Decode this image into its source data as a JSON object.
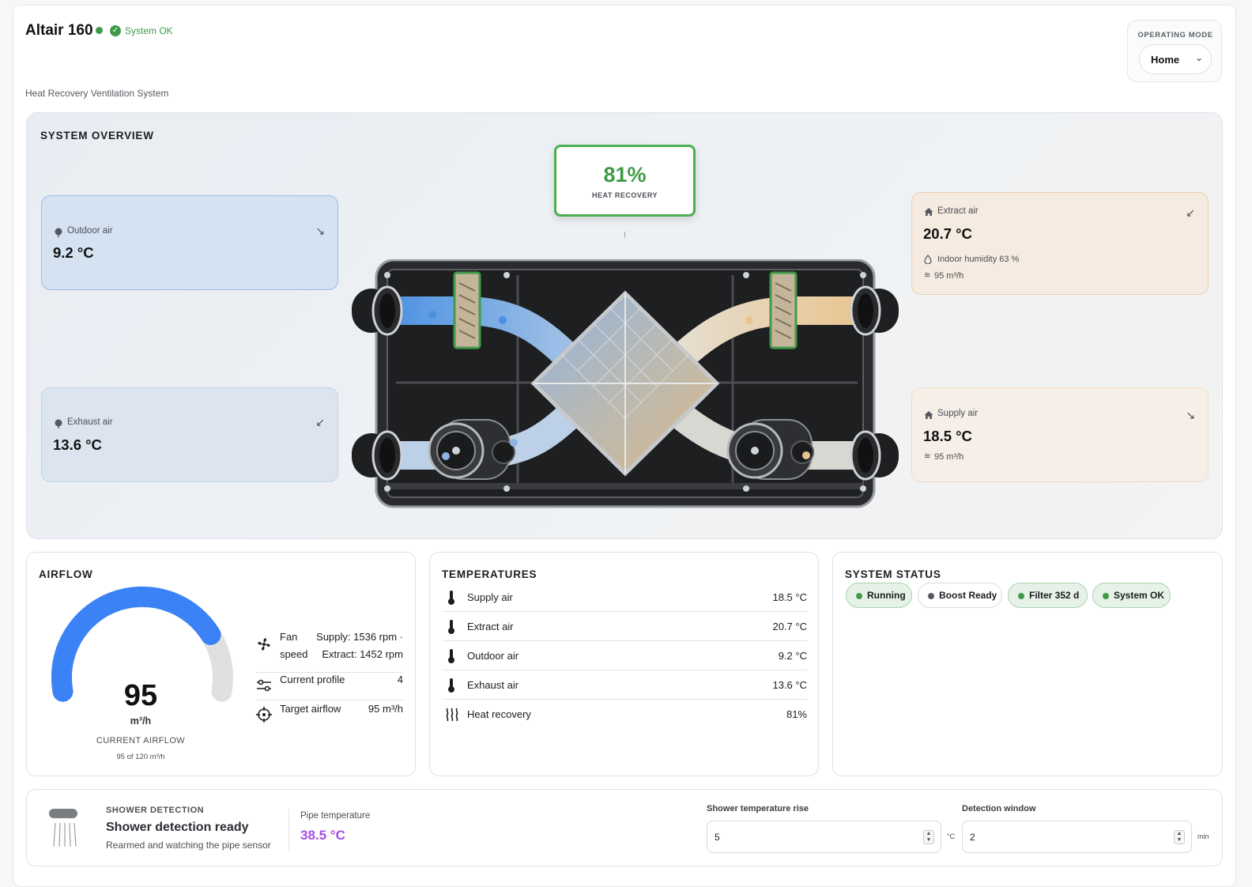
{
  "header": {
    "title": "Altair 160",
    "status_text": "System OK",
    "subtitle": "Heat Recovery Ventilation System",
    "operating_mode_label": "OPERATING MODE",
    "operating_mode_value": "Home",
    "status_color": "#3f9b4a"
  },
  "overview": {
    "title": "SYSTEM OVERVIEW",
    "heat_recovery_value": "81%",
    "heat_recovery_label": "HEAT RECOVERY",
    "outdoor": {
      "name": "Outdoor air",
      "temp": "9.2 °C",
      "arrow": "↘"
    },
    "exhaust": {
      "name": "Exhaust air",
      "temp": "13.6 °C",
      "arrow": "↙"
    },
    "extract": {
      "name": "Extract air",
      "temp": "20.7 °C",
      "humidity": "Indoor humidity 63 %",
      "flow": "95 m³/h",
      "arrow": "↙"
    },
    "supply": {
      "name": "Supply air",
      "temp": "18.5 °C",
      "flow": "95 m³/h",
      "arrow": "↘"
    },
    "colors": {
      "cold": "#4a90e2",
      "warm": "#e8c48e",
      "accent": "#4caf50"
    }
  },
  "airflow": {
    "title": "AIRFLOW",
    "current": "95",
    "unit": "m³/h",
    "label": "CURRENT AIRFLOW",
    "sub": "95 of 120 m³/h",
    "fraction": 0.79,
    "gauge_color": "#3b82f6",
    "fan_speed_label_1": "Fan",
    "fan_speed_label_2": "speed",
    "fan_supply": "Supply: 1536 rpm ·",
    "fan_extract": "Extract: 1452 rpm",
    "profile_label": "Current profile",
    "profile_value": "4",
    "target_label": "Target airflow",
    "target_value": "95 m³/h"
  },
  "temperatures": {
    "title": "TEMPERATURES",
    "rows": [
      {
        "name": "Supply air",
        "value": "18.5 °C",
        "icon": "thermometer-icon"
      },
      {
        "name": "Extract air",
        "value": "20.7 °C",
        "icon": "thermometer-icon"
      },
      {
        "name": "Outdoor air",
        "value": "9.2 °C",
        "icon": "thermometer-icon"
      },
      {
        "name": "Exhaust air",
        "value": "13.6 °C",
        "icon": "thermometer-icon"
      },
      {
        "name": "Heat recovery",
        "value": "81%",
        "icon": "heat-waves-icon"
      }
    ]
  },
  "system_status": {
    "title": "SYSTEM STATUS",
    "chips": [
      {
        "label": "Running",
        "color": "#3f9b4a"
      },
      {
        "label": "Boost Ready",
        "color": "#555a60"
      },
      {
        "label": "Filter 352 d",
        "color": "#3f9b4a"
      },
      {
        "label": "System OK",
        "color": "#3f9b4a"
      }
    ]
  },
  "shower": {
    "label": "SHOWER DETECTION",
    "title": "Shower detection ready",
    "subtitle": "Rearmed and watching the pipe sensor",
    "pipe_label": "Pipe temperature",
    "pipe_value": "38.5 °C",
    "rise_label": "Shower temperature rise",
    "rise_value": "5",
    "rise_unit": "°C",
    "window_label": "Detection window",
    "window_value": "2",
    "window_unit": "min"
  }
}
